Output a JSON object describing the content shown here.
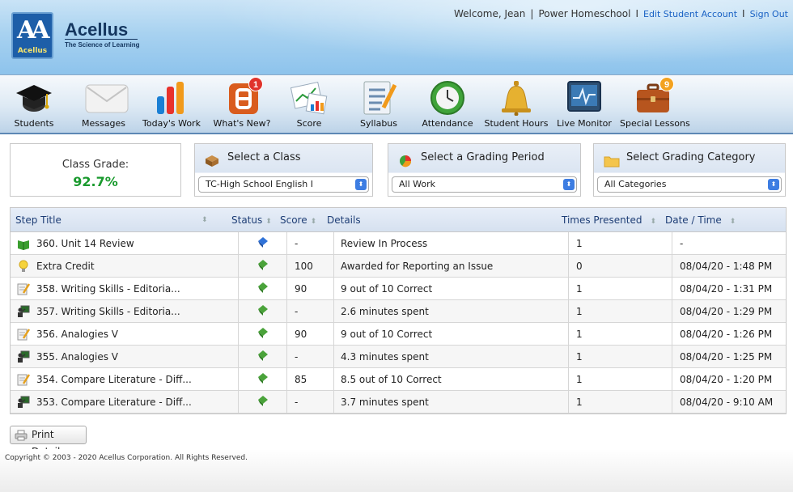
{
  "brand": {
    "logo_text": "Acellus",
    "name": "Acellus",
    "tagline": "The Science of Learning"
  },
  "top_links": {
    "welcome": "Welcome, Jean",
    "school": "Power Homeschool",
    "edit_account": "Edit Student Account",
    "sign_out": "Sign Out"
  },
  "toolbar": [
    {
      "label": "Students",
      "icon": "graduation-cap-icon"
    },
    {
      "label": "Messages",
      "icon": "envelope-icon"
    },
    {
      "label": "Today's Work",
      "icon": "bar-chart-icon"
    },
    {
      "label": "What's New?",
      "icon": "blogger-icon",
      "badge": "1"
    },
    {
      "label": "Score",
      "icon": "score-chart-icon"
    },
    {
      "label": "Syllabus",
      "icon": "syllabus-list-icon"
    },
    {
      "label": "Attendance",
      "icon": "clock-icon"
    },
    {
      "label": "Student Hours",
      "icon": "bell-icon"
    },
    {
      "label": "Live Monitor",
      "icon": "monitor-icon"
    },
    {
      "label": "Special Lessons",
      "icon": "briefcase-icon",
      "badge": "9"
    }
  ],
  "class_grade": {
    "label": "Class Grade:",
    "value": "92.7%"
  },
  "filters": {
    "class": {
      "title": "Select a Class",
      "value": "TC-High School English I"
    },
    "grading_period": {
      "title": "Select a Grading Period",
      "value": "All Work"
    },
    "category": {
      "title": "Select Grading Category",
      "value": "All Categories"
    }
  },
  "table": {
    "headers": {
      "step_title": "Step Title",
      "status": "Status",
      "score": "Score",
      "details": "Details",
      "times_presented": "Times Presented",
      "date_time": "Date / Time"
    },
    "rows": [
      {
        "icon": "green-book-icon",
        "title": "360. Unit 14 Review",
        "status": "blue",
        "score": "-",
        "details": "Review In Process",
        "times": "1",
        "date": "-"
      },
      {
        "icon": "lightbulb-icon",
        "title": "Extra Credit",
        "status": "green",
        "score": "100",
        "details": "Awarded for Reporting an Issue",
        "times": "0",
        "date": "08/04/20 - 1:48 PM"
      },
      {
        "icon": "pencil-paper-icon",
        "title": "358. Writing Skills - Editoria...",
        "status": "green",
        "score": "90",
        "details": "9 out of 10 Correct",
        "times": "1",
        "date": "08/04/20 - 1:31 PM"
      },
      {
        "icon": "lecture-icon",
        "title": "357. Writing Skills - Editoria...",
        "status": "green",
        "score": "-",
        "details": "2.6 minutes spent",
        "times": "1",
        "date": "08/04/20 - 1:29 PM"
      },
      {
        "icon": "pencil-paper-icon",
        "title": "356. Analogies V",
        "status": "green",
        "score": "90",
        "details": "9 out of 10 Correct",
        "times": "1",
        "date": "08/04/20 - 1:26 PM"
      },
      {
        "icon": "lecture-icon",
        "title": "355. Analogies V",
        "status": "green",
        "score": "-",
        "details": "4.3 minutes spent",
        "times": "1",
        "date": "08/04/20 - 1:25 PM"
      },
      {
        "icon": "pencil-paper-icon",
        "title": "354. Compare Literature - Diff...",
        "status": "green",
        "score": "85",
        "details": "8.5 out of 10 Correct",
        "times": "1",
        "date": "08/04/20 - 1:20 PM"
      },
      {
        "icon": "lecture-icon",
        "title": "353. Compare Literature - Diff...",
        "status": "green",
        "score": "-",
        "details": "3.7 minutes spent",
        "times": "1",
        "date": "08/04/20 - 9:10 AM"
      }
    ]
  },
  "print_button": "Print Details",
  "copyright": "Copyright © 2003 - 2020 Acellus Corporation.  All Rights Reserved.",
  "colors": {
    "grade": "#1a9a2e",
    "link": "#1a62c4",
    "header_text": "#1d3d75"
  }
}
